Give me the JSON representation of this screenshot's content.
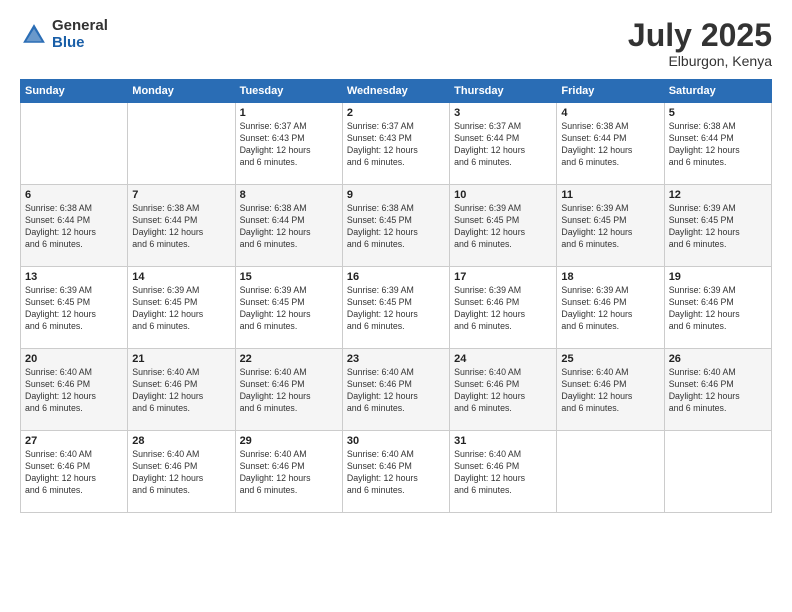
{
  "logo": {
    "general": "General",
    "blue": "Blue"
  },
  "title": "July 2025",
  "subtitle": "Elburgon, Kenya",
  "days_header": [
    "Sunday",
    "Monday",
    "Tuesday",
    "Wednesday",
    "Thursday",
    "Friday",
    "Saturday"
  ],
  "weeks": [
    [
      {
        "day": "",
        "detail": ""
      },
      {
        "day": "",
        "detail": ""
      },
      {
        "day": "1",
        "detail": "Sunrise: 6:37 AM\nSunset: 6:43 PM\nDaylight: 12 hours\nand 6 minutes."
      },
      {
        "day": "2",
        "detail": "Sunrise: 6:37 AM\nSunset: 6:43 PM\nDaylight: 12 hours\nand 6 minutes."
      },
      {
        "day": "3",
        "detail": "Sunrise: 6:37 AM\nSunset: 6:44 PM\nDaylight: 12 hours\nand 6 minutes."
      },
      {
        "day": "4",
        "detail": "Sunrise: 6:38 AM\nSunset: 6:44 PM\nDaylight: 12 hours\nand 6 minutes."
      },
      {
        "day": "5",
        "detail": "Sunrise: 6:38 AM\nSunset: 6:44 PM\nDaylight: 12 hours\nand 6 minutes."
      }
    ],
    [
      {
        "day": "6",
        "detail": "Sunrise: 6:38 AM\nSunset: 6:44 PM\nDaylight: 12 hours\nand 6 minutes."
      },
      {
        "day": "7",
        "detail": "Sunrise: 6:38 AM\nSunset: 6:44 PM\nDaylight: 12 hours\nand 6 minutes."
      },
      {
        "day": "8",
        "detail": "Sunrise: 6:38 AM\nSunset: 6:44 PM\nDaylight: 12 hours\nand 6 minutes."
      },
      {
        "day": "9",
        "detail": "Sunrise: 6:38 AM\nSunset: 6:45 PM\nDaylight: 12 hours\nand 6 minutes."
      },
      {
        "day": "10",
        "detail": "Sunrise: 6:39 AM\nSunset: 6:45 PM\nDaylight: 12 hours\nand 6 minutes."
      },
      {
        "day": "11",
        "detail": "Sunrise: 6:39 AM\nSunset: 6:45 PM\nDaylight: 12 hours\nand 6 minutes."
      },
      {
        "day": "12",
        "detail": "Sunrise: 6:39 AM\nSunset: 6:45 PM\nDaylight: 12 hours\nand 6 minutes."
      }
    ],
    [
      {
        "day": "13",
        "detail": "Sunrise: 6:39 AM\nSunset: 6:45 PM\nDaylight: 12 hours\nand 6 minutes."
      },
      {
        "day": "14",
        "detail": "Sunrise: 6:39 AM\nSunset: 6:45 PM\nDaylight: 12 hours\nand 6 minutes."
      },
      {
        "day": "15",
        "detail": "Sunrise: 6:39 AM\nSunset: 6:45 PM\nDaylight: 12 hours\nand 6 minutes."
      },
      {
        "day": "16",
        "detail": "Sunrise: 6:39 AM\nSunset: 6:45 PM\nDaylight: 12 hours\nand 6 minutes."
      },
      {
        "day": "17",
        "detail": "Sunrise: 6:39 AM\nSunset: 6:46 PM\nDaylight: 12 hours\nand 6 minutes."
      },
      {
        "day": "18",
        "detail": "Sunrise: 6:39 AM\nSunset: 6:46 PM\nDaylight: 12 hours\nand 6 minutes."
      },
      {
        "day": "19",
        "detail": "Sunrise: 6:39 AM\nSunset: 6:46 PM\nDaylight: 12 hours\nand 6 minutes."
      }
    ],
    [
      {
        "day": "20",
        "detail": "Sunrise: 6:40 AM\nSunset: 6:46 PM\nDaylight: 12 hours\nand 6 minutes."
      },
      {
        "day": "21",
        "detail": "Sunrise: 6:40 AM\nSunset: 6:46 PM\nDaylight: 12 hours\nand 6 minutes."
      },
      {
        "day": "22",
        "detail": "Sunrise: 6:40 AM\nSunset: 6:46 PM\nDaylight: 12 hours\nand 6 minutes."
      },
      {
        "day": "23",
        "detail": "Sunrise: 6:40 AM\nSunset: 6:46 PM\nDaylight: 12 hours\nand 6 minutes."
      },
      {
        "day": "24",
        "detail": "Sunrise: 6:40 AM\nSunset: 6:46 PM\nDaylight: 12 hours\nand 6 minutes."
      },
      {
        "day": "25",
        "detail": "Sunrise: 6:40 AM\nSunset: 6:46 PM\nDaylight: 12 hours\nand 6 minutes."
      },
      {
        "day": "26",
        "detail": "Sunrise: 6:40 AM\nSunset: 6:46 PM\nDaylight: 12 hours\nand 6 minutes."
      }
    ],
    [
      {
        "day": "27",
        "detail": "Sunrise: 6:40 AM\nSunset: 6:46 PM\nDaylight: 12 hours\nand 6 minutes."
      },
      {
        "day": "28",
        "detail": "Sunrise: 6:40 AM\nSunset: 6:46 PM\nDaylight: 12 hours\nand 6 minutes."
      },
      {
        "day": "29",
        "detail": "Sunrise: 6:40 AM\nSunset: 6:46 PM\nDaylight: 12 hours\nand 6 minutes."
      },
      {
        "day": "30",
        "detail": "Sunrise: 6:40 AM\nSunset: 6:46 PM\nDaylight: 12 hours\nand 6 minutes."
      },
      {
        "day": "31",
        "detail": "Sunrise: 6:40 AM\nSunset: 6:46 PM\nDaylight: 12 hours\nand 6 minutes."
      },
      {
        "day": "",
        "detail": ""
      },
      {
        "day": "",
        "detail": ""
      }
    ]
  ]
}
